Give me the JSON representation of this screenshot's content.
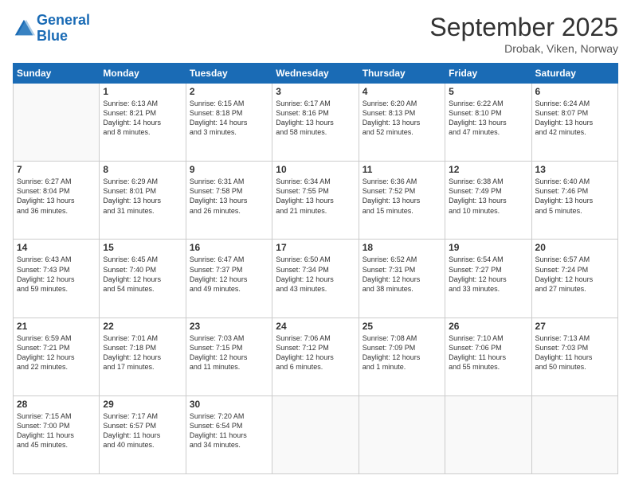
{
  "logo": {
    "line1": "General",
    "line2": "Blue"
  },
  "header": {
    "month": "September 2025",
    "location": "Drobak, Viken, Norway"
  },
  "weekdays": [
    "Sunday",
    "Monday",
    "Tuesday",
    "Wednesday",
    "Thursday",
    "Friday",
    "Saturday"
  ],
  "weeks": [
    [
      {
        "day": "",
        "info": ""
      },
      {
        "day": "1",
        "info": "Sunrise: 6:13 AM\nSunset: 8:21 PM\nDaylight: 14 hours\nand 8 minutes."
      },
      {
        "day": "2",
        "info": "Sunrise: 6:15 AM\nSunset: 8:18 PM\nDaylight: 14 hours\nand 3 minutes."
      },
      {
        "day": "3",
        "info": "Sunrise: 6:17 AM\nSunset: 8:16 PM\nDaylight: 13 hours\nand 58 minutes."
      },
      {
        "day": "4",
        "info": "Sunrise: 6:20 AM\nSunset: 8:13 PM\nDaylight: 13 hours\nand 52 minutes."
      },
      {
        "day": "5",
        "info": "Sunrise: 6:22 AM\nSunset: 8:10 PM\nDaylight: 13 hours\nand 47 minutes."
      },
      {
        "day": "6",
        "info": "Sunrise: 6:24 AM\nSunset: 8:07 PM\nDaylight: 13 hours\nand 42 minutes."
      }
    ],
    [
      {
        "day": "7",
        "info": "Sunrise: 6:27 AM\nSunset: 8:04 PM\nDaylight: 13 hours\nand 36 minutes."
      },
      {
        "day": "8",
        "info": "Sunrise: 6:29 AM\nSunset: 8:01 PM\nDaylight: 13 hours\nand 31 minutes."
      },
      {
        "day": "9",
        "info": "Sunrise: 6:31 AM\nSunset: 7:58 PM\nDaylight: 13 hours\nand 26 minutes."
      },
      {
        "day": "10",
        "info": "Sunrise: 6:34 AM\nSunset: 7:55 PM\nDaylight: 13 hours\nand 21 minutes."
      },
      {
        "day": "11",
        "info": "Sunrise: 6:36 AM\nSunset: 7:52 PM\nDaylight: 13 hours\nand 15 minutes."
      },
      {
        "day": "12",
        "info": "Sunrise: 6:38 AM\nSunset: 7:49 PM\nDaylight: 13 hours\nand 10 minutes."
      },
      {
        "day": "13",
        "info": "Sunrise: 6:40 AM\nSunset: 7:46 PM\nDaylight: 13 hours\nand 5 minutes."
      }
    ],
    [
      {
        "day": "14",
        "info": "Sunrise: 6:43 AM\nSunset: 7:43 PM\nDaylight: 12 hours\nand 59 minutes."
      },
      {
        "day": "15",
        "info": "Sunrise: 6:45 AM\nSunset: 7:40 PM\nDaylight: 12 hours\nand 54 minutes."
      },
      {
        "day": "16",
        "info": "Sunrise: 6:47 AM\nSunset: 7:37 PM\nDaylight: 12 hours\nand 49 minutes."
      },
      {
        "day": "17",
        "info": "Sunrise: 6:50 AM\nSunset: 7:34 PM\nDaylight: 12 hours\nand 43 minutes."
      },
      {
        "day": "18",
        "info": "Sunrise: 6:52 AM\nSunset: 7:31 PM\nDaylight: 12 hours\nand 38 minutes."
      },
      {
        "day": "19",
        "info": "Sunrise: 6:54 AM\nSunset: 7:27 PM\nDaylight: 12 hours\nand 33 minutes."
      },
      {
        "day": "20",
        "info": "Sunrise: 6:57 AM\nSunset: 7:24 PM\nDaylight: 12 hours\nand 27 minutes."
      }
    ],
    [
      {
        "day": "21",
        "info": "Sunrise: 6:59 AM\nSunset: 7:21 PM\nDaylight: 12 hours\nand 22 minutes."
      },
      {
        "day": "22",
        "info": "Sunrise: 7:01 AM\nSunset: 7:18 PM\nDaylight: 12 hours\nand 17 minutes."
      },
      {
        "day": "23",
        "info": "Sunrise: 7:03 AM\nSunset: 7:15 PM\nDaylight: 12 hours\nand 11 minutes."
      },
      {
        "day": "24",
        "info": "Sunrise: 7:06 AM\nSunset: 7:12 PM\nDaylight: 12 hours\nand 6 minutes."
      },
      {
        "day": "25",
        "info": "Sunrise: 7:08 AM\nSunset: 7:09 PM\nDaylight: 12 hours\nand 1 minute."
      },
      {
        "day": "26",
        "info": "Sunrise: 7:10 AM\nSunset: 7:06 PM\nDaylight: 11 hours\nand 55 minutes."
      },
      {
        "day": "27",
        "info": "Sunrise: 7:13 AM\nSunset: 7:03 PM\nDaylight: 11 hours\nand 50 minutes."
      }
    ],
    [
      {
        "day": "28",
        "info": "Sunrise: 7:15 AM\nSunset: 7:00 PM\nDaylight: 11 hours\nand 45 minutes."
      },
      {
        "day": "29",
        "info": "Sunrise: 7:17 AM\nSunset: 6:57 PM\nDaylight: 11 hours\nand 40 minutes."
      },
      {
        "day": "30",
        "info": "Sunrise: 7:20 AM\nSunset: 6:54 PM\nDaylight: 11 hours\nand 34 minutes."
      },
      {
        "day": "",
        "info": ""
      },
      {
        "day": "",
        "info": ""
      },
      {
        "day": "",
        "info": ""
      },
      {
        "day": "",
        "info": ""
      }
    ]
  ]
}
